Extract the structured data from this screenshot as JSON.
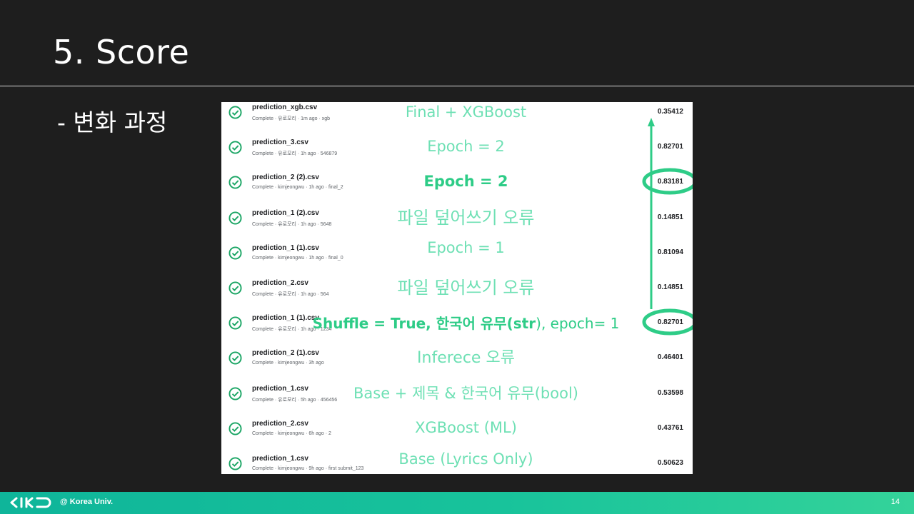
{
  "slide": {
    "title": "5. Score",
    "subtitle": "- 변화 과정",
    "page_number": "14"
  },
  "footer": {
    "logo": "KIKD",
    "text": "@ Korea Univ."
  },
  "submissions": [
    {
      "file": "prediction_xgb.csv",
      "meta": "Complete · 유로모리 · 1m ago · xgb",
      "score": "0.35412"
    },
    {
      "file": "prediction_3.csv",
      "meta": "Complete · 유로모리 · 1h ago · 546879",
      "score": "0.82701"
    },
    {
      "file": "prediction_2 (2).csv",
      "meta": "Complete · kimjeongwu · 1h ago · final_2",
      "score": "0.83181"
    },
    {
      "file": "prediction_1 (2).csv",
      "meta": "Complete · 유로모리 · 1h ago · 5648",
      "score": "0.14851"
    },
    {
      "file": "prediction_1 (1).csv",
      "meta": "Complete · kimjeongwu · 1h ago · final_0",
      "score": "0.81094"
    },
    {
      "file": "prediction_2.csv",
      "meta": "Complete · 유로모리 · 1h ago · 564",
      "score": "0.14851"
    },
    {
      "file": "prediction_1 (1).csv",
      "meta": "Complete · 유로모리 · 1h ago · 1234",
      "score": "0.82701"
    },
    {
      "file": "prediction_2 (1).csv",
      "meta": "Complete · kimjeongwu · 3h ago",
      "score": "0.46401"
    },
    {
      "file": "prediction_1.csv",
      "meta": "Complete · 유로모리 · 5h ago · 456456",
      "score": "0.53598"
    },
    {
      "file": "prediction_2.csv",
      "meta": "Complete · kimjeongwu · 6h ago · 2",
      "score": "0.43761"
    },
    {
      "file": "prediction_1.csv",
      "meta": "Complete · kimjeongwu · 9h ago · first submit_123",
      "score": "0.50623"
    }
  ],
  "annotations": [
    "Final + XGBoost",
    "Epoch = 2",
    "Epoch = 2",
    "파일 덮어쓰기 오류",
    "Epoch = 1",
    "파일 덮어쓰기 오류",
    "",
    "Inferece 오류",
    "Base + 제목 & 한국어 유무(bool)",
    "XGBoost (ML)",
    "Base (Lyrics Only)"
  ],
  "annotation_row7": {
    "bold_part": "Shuffle = True, 한국어 유무(str",
    "normal_part": "), epoch= 1"
  },
  "colors": {
    "accent": "#2ecc87",
    "annotation_light": "#6ee0b4",
    "check": "#1aa564"
  }
}
